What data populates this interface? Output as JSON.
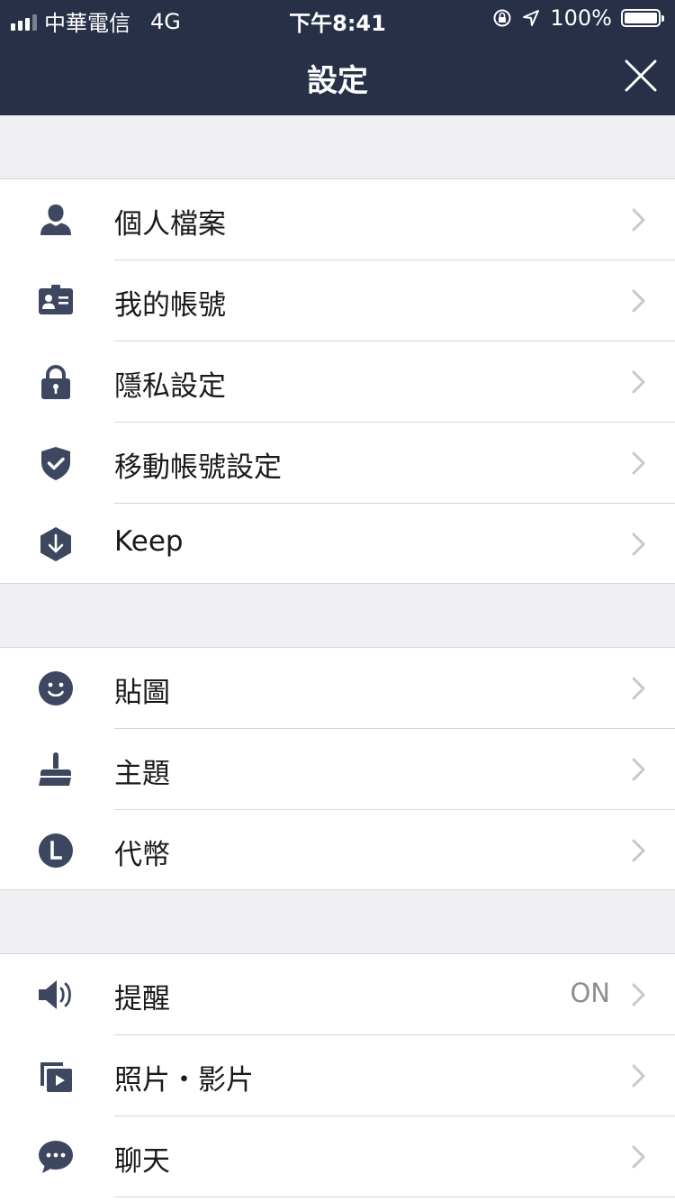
{
  "status_bar": {
    "carrier": "中華電信",
    "network": "4G",
    "time": "下午8:41",
    "battery": "100%"
  },
  "header": {
    "title": "設定"
  },
  "groups": [
    {
      "items": [
        {
          "label": "個人檔案",
          "icon": "person-icon"
        },
        {
          "label": "我的帳號",
          "icon": "id-card-icon"
        },
        {
          "label": "隱私設定",
          "icon": "lock-icon"
        },
        {
          "label": "移動帳號設定",
          "icon": "shield-icon"
        },
        {
          "label": "Keep",
          "icon": "keep-download-icon"
        }
      ]
    },
    {
      "items": [
        {
          "label": "貼圖",
          "icon": "smiley-icon"
        },
        {
          "label": "主題",
          "icon": "brush-icon"
        },
        {
          "label": "代幣",
          "icon": "coin-icon"
        }
      ]
    },
    {
      "items": [
        {
          "label": "提醒",
          "value": "ON",
          "icon": "speaker-icon"
        },
        {
          "label": "照片・影片",
          "icon": "photo-video-icon"
        },
        {
          "label": "聊天",
          "icon": "chat-bubble-icon"
        }
      ]
    }
  ],
  "colors": {
    "header_bg": "#273047",
    "icon": "#3e4760",
    "chevron": "#c7c7cc",
    "background": "#efeff4"
  }
}
